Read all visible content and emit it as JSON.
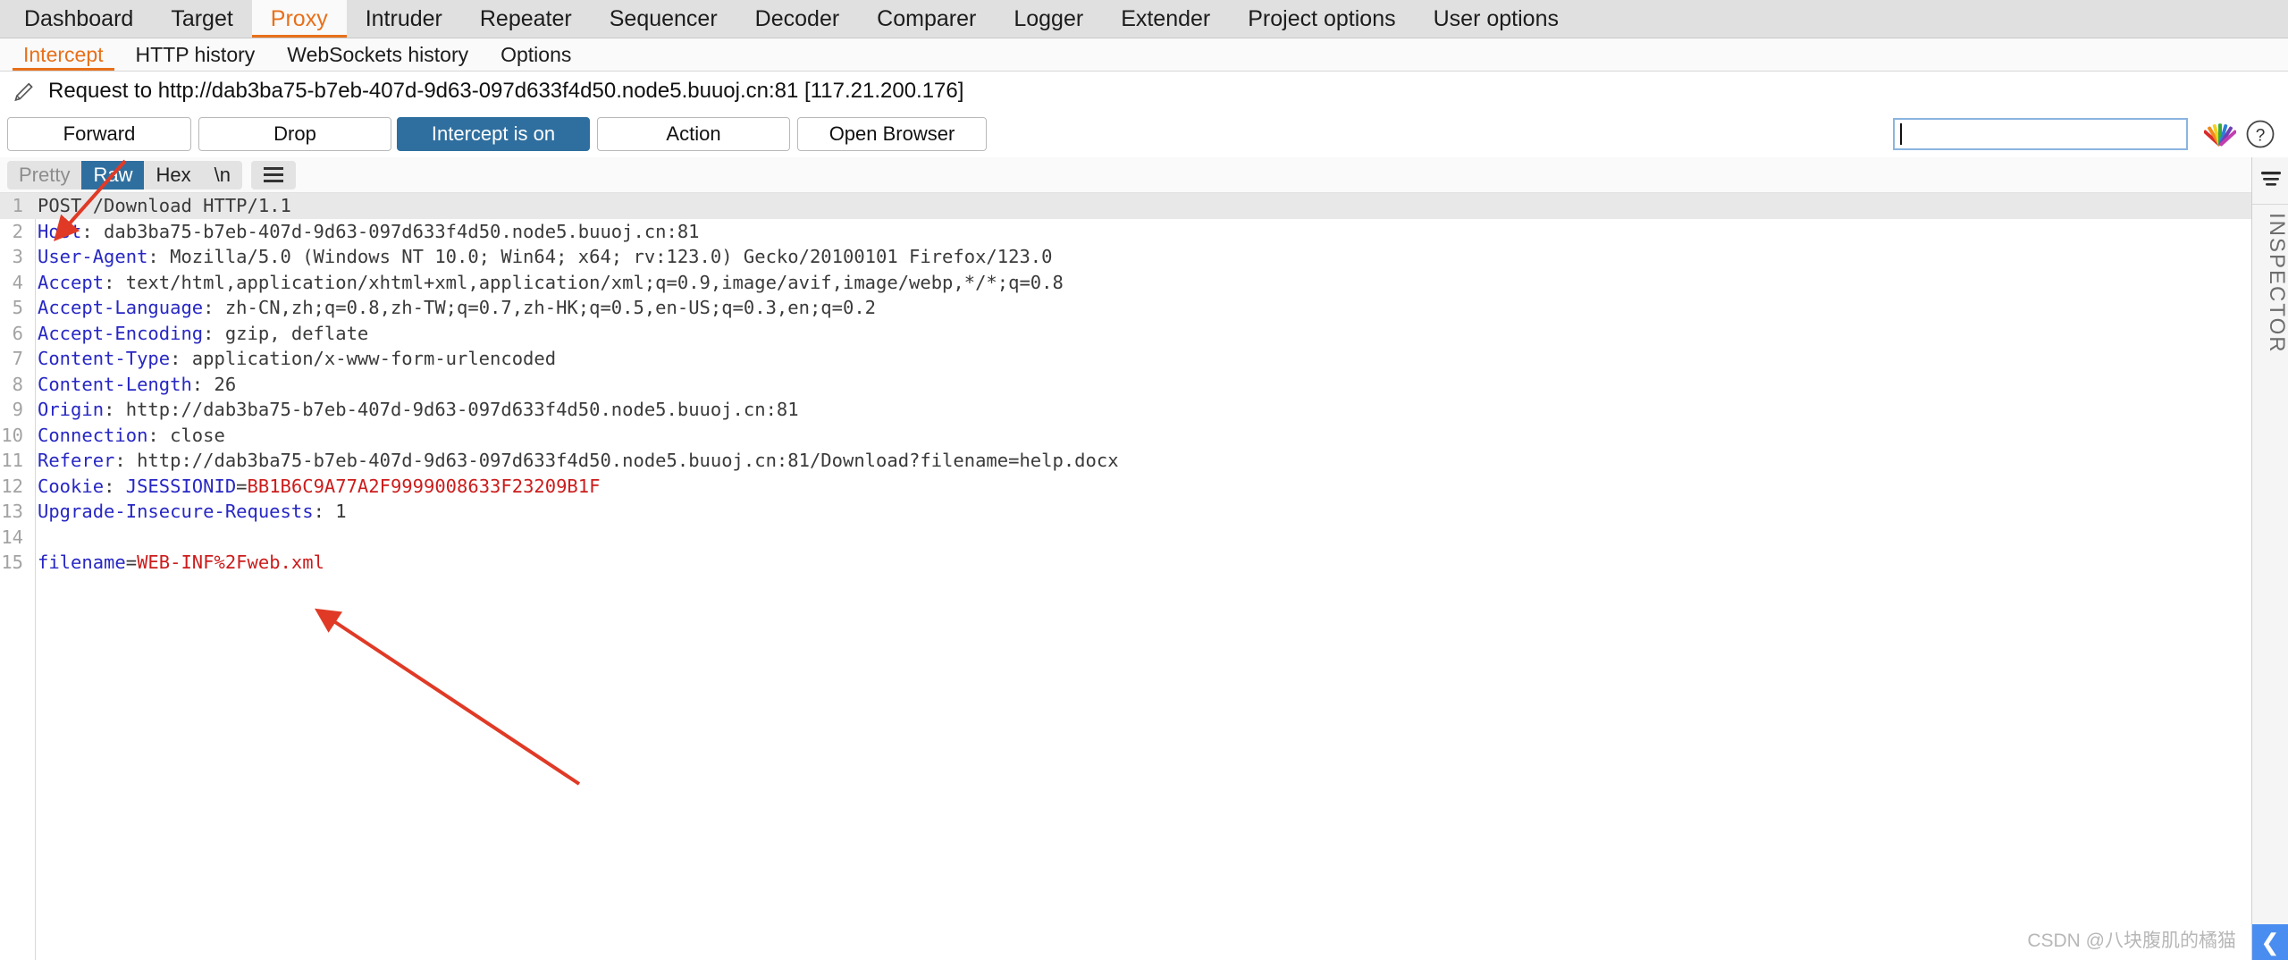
{
  "main_tabs": [
    {
      "label": "Dashboard",
      "active": false
    },
    {
      "label": "Target",
      "active": false
    },
    {
      "label": "Proxy",
      "active": true
    },
    {
      "label": "Intruder",
      "active": false
    },
    {
      "label": "Repeater",
      "active": false
    },
    {
      "label": "Sequencer",
      "active": false
    },
    {
      "label": "Decoder",
      "active": false
    },
    {
      "label": "Comparer",
      "active": false
    },
    {
      "label": "Logger",
      "active": false
    },
    {
      "label": "Extender",
      "active": false
    },
    {
      "label": "Project options",
      "active": false
    },
    {
      "label": "User options",
      "active": false
    }
  ],
  "sub_tabs": [
    {
      "label": "Intercept",
      "active": true
    },
    {
      "label": "HTTP history",
      "active": false
    },
    {
      "label": "WebSockets history",
      "active": false
    },
    {
      "label": "Options",
      "active": false
    }
  ],
  "request_title": {
    "icon": "pencil-icon",
    "text": "Request to http://dab3ba75-b7eb-407d-9d63-097d633f4d50.node5.buuoj.cn:81  [117.21.200.176]"
  },
  "buttons": {
    "forward": "Forward",
    "drop": "Drop",
    "intercept": "Intercept is on",
    "action": "Action",
    "open_browser": "Open Browser"
  },
  "search": {
    "value": "",
    "placeholder": ""
  },
  "editor_toolbar": {
    "pretty": "Pretty",
    "raw": "Raw",
    "hex": "Hex",
    "newline": "\\n",
    "menu_icon": "hamburger-menu-icon"
  },
  "inspector": {
    "label": "INSPECTOR",
    "icon": "layers-icon"
  },
  "colors": {
    "accent": "#e8701a",
    "primary_button": "#2f6f9f",
    "header_name": "#2727c4",
    "value_red": "#cc1c1c",
    "gutter_text": "#a3a3a3",
    "annotation_red": "#e03a26"
  },
  "code": {
    "lines": [
      {
        "n": "1",
        "highlight": true,
        "segments": [
          {
            "t": "POST /Download HTTP/1.1",
            "c": "plain"
          }
        ]
      },
      {
        "n": "2",
        "highlight": false,
        "segments": [
          {
            "t": "Host",
            "c": "name"
          },
          {
            "t": ": dab3ba75-b7eb-407d-9d63-097d633f4d50.node5.buuoj.cn:81",
            "c": "plain"
          }
        ]
      },
      {
        "n": "3",
        "highlight": false,
        "segments": [
          {
            "t": "User-Agent",
            "c": "name"
          },
          {
            "t": ": Mozilla/5.0 (Windows NT 10.0; Win64; x64; rv:123.0) Gecko/20100101 Firefox/123.0",
            "c": "plain"
          }
        ]
      },
      {
        "n": "4",
        "highlight": false,
        "segments": [
          {
            "t": "Accept",
            "c": "name"
          },
          {
            "t": ": text/html,application/xhtml+xml,application/xml;q=0.9,image/avif,image/webp,*/*;q=0.8",
            "c": "plain"
          }
        ]
      },
      {
        "n": "5",
        "highlight": false,
        "segments": [
          {
            "t": "Accept-Language",
            "c": "name"
          },
          {
            "t": ": zh-CN,zh;q=0.8,zh-TW;q=0.7,zh-HK;q=0.5,en-US;q=0.3,en;q=0.2",
            "c": "plain"
          }
        ]
      },
      {
        "n": "6",
        "highlight": false,
        "segments": [
          {
            "t": "Accept-Encoding",
            "c": "name"
          },
          {
            "t": ": gzip, deflate",
            "c": "plain"
          }
        ]
      },
      {
        "n": "7",
        "highlight": false,
        "segments": [
          {
            "t": "Content-Type",
            "c": "name"
          },
          {
            "t": ": application/x-www-form-urlencoded",
            "c": "plain"
          }
        ]
      },
      {
        "n": "8",
        "highlight": false,
        "segments": [
          {
            "t": "Content-Length",
            "c": "name"
          },
          {
            "t": ": 26",
            "c": "plain"
          }
        ]
      },
      {
        "n": "9",
        "highlight": false,
        "segments": [
          {
            "t": "Origin",
            "c": "name"
          },
          {
            "t": ": http://dab3ba75-b7eb-407d-9d63-097d633f4d50.node5.buuoj.cn:81",
            "c": "plain"
          }
        ]
      },
      {
        "n": "10",
        "highlight": false,
        "segments": [
          {
            "t": "Connection",
            "c": "name"
          },
          {
            "t": ": close",
            "c": "plain"
          }
        ]
      },
      {
        "n": "11",
        "highlight": false,
        "segments": [
          {
            "t": "Referer",
            "c": "name"
          },
          {
            "t": ": http://dab3ba75-b7eb-407d-9d63-097d633f4d50.node5.buuoj.cn:81/Download?filename=help.docx",
            "c": "plain"
          }
        ]
      },
      {
        "n": "12",
        "highlight": false,
        "segments": [
          {
            "t": "Cookie",
            "c": "name"
          },
          {
            "t": ": ",
            "c": "plain"
          },
          {
            "t": "JSESSIONID",
            "c": "name"
          },
          {
            "t": "=",
            "c": "plain"
          },
          {
            "t": "BB1B6C9A77A2F9999008633F23209B1F",
            "c": "red"
          }
        ]
      },
      {
        "n": "13",
        "highlight": false,
        "segments": [
          {
            "t": "Upgrade-Insecure-Requests",
            "c": "name"
          },
          {
            "t": ": 1",
            "c": "plain"
          }
        ]
      },
      {
        "n": "14",
        "highlight": false,
        "segments": []
      },
      {
        "n": "15",
        "highlight": false,
        "segments": [
          {
            "t": "filename",
            "c": "name"
          },
          {
            "t": "=",
            "c": "plain"
          },
          {
            "t": "WEB-INF%2Fweb.xml",
            "c": "red"
          }
        ]
      }
    ]
  },
  "watermark": {
    "text": "CSDN @八块腹肌的橘猫",
    "chevron": "❮"
  }
}
